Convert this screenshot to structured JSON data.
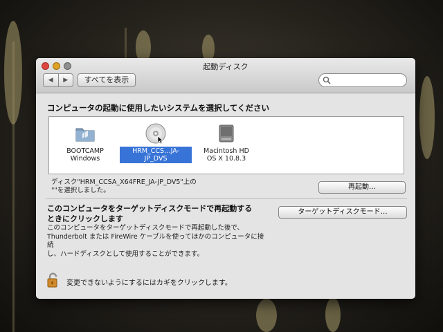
{
  "window": {
    "title": "起動ディスク",
    "nav_back": "◀",
    "nav_forward": "▶",
    "show_all_label": "すべてを表示",
    "search_placeholder": ""
  },
  "main": {
    "heading": "コンピュータの起動に使用したいシステムを選択してください",
    "disks": [
      {
        "label_line1": "BOOTCAMP",
        "label_line2": "Windows",
        "icon": "folder-disk-icon",
        "selected": false
      },
      {
        "label_line1": "HRM_CCS…JA-JP_DVS",
        "label_line2": "",
        "icon": "dvd-disk-icon",
        "selected": true
      },
      {
        "label_line1": "Macintosh HD",
        "label_line2": "OS X 10.8.3",
        "icon": "hard-drive-icon",
        "selected": false
      }
    ],
    "status_line1": "ディスク\"HRM_CCSA_X64FRE_JA-JP_DV5\"上の",
    "status_line2": "\"\"を選択しました。",
    "restart_label": "再起動…"
  },
  "target_disk": {
    "title_line1": "このコンピュータをターゲットディスクモードで再起動する",
    "title_line2": "ときにクリックします",
    "desc_line1": "このコンピュータをターゲットディスクモードで再起動した後で、",
    "desc_line2": "Thunderbolt または FireWire ケーブルを使ってほかのコンピュータに接続",
    "desc_line3": "し、ハードディスクとして使用することができます。",
    "button_label": "ターゲットディスクモード…"
  },
  "footer": {
    "lock_text": "変更できないようにするにはカギをクリックします。"
  },
  "colors": {
    "selection": "#3874d7",
    "lock": "#d08a2a"
  }
}
